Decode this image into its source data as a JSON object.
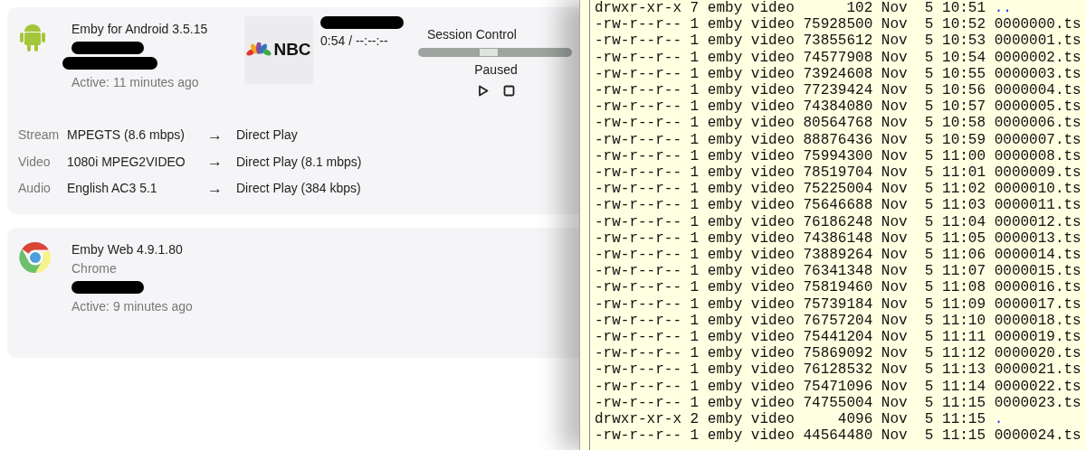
{
  "sessions": [
    {
      "kind": "android",
      "app": "Emby for Android 3.5.15",
      "redactions": [
        {
          "kind": "redaction"
        },
        {
          "kind": "redaction"
        }
      ],
      "active": "Active: 11 minutes ago",
      "media": {
        "logo": "NBC",
        "position": "0:54 / --:--:--"
      },
      "control": {
        "title": "Session Control",
        "level": 0.46,
        "state": "Paused"
      },
      "streams": [
        {
          "label": "Stream",
          "source": "MPEGTS (8.6 mbps)",
          "arrow": "→",
          "target": "Direct Play"
        },
        {
          "label": "Video",
          "source": "1080i MPEG2VIDEO",
          "arrow": "→",
          "target": "Direct Play (8.1 mbps)"
        },
        {
          "label": "Audio",
          "source": "English AC3 5.1",
          "arrow": "→",
          "target": "Direct Play (384 kbps)"
        }
      ]
    },
    {
      "kind": "chrome",
      "app": "Emby Web 4.9.1.80",
      "client": "Chrome",
      "redactions": [
        {
          "kind": "redaction"
        }
      ],
      "active": "Active: 9 minutes ago"
    }
  ],
  "terminal": {
    "lines": [
      {
        "info": "drwxr-xr-x 7 emby video      102 Nov  5 10:51",
        "name": "..",
        "kind": "dir"
      },
      {
        "info": "-rw-r--r-- 1 emby video 75928500 Nov  5 10:52",
        "name": "0000000.ts",
        "kind": "file"
      },
      {
        "info": "-rw-r--r-- 1 emby video 73855612 Nov  5 10:53",
        "name": "0000001.ts",
        "kind": "file"
      },
      {
        "info": "-rw-r--r-- 1 emby video 74577908 Nov  5 10:54",
        "name": "0000002.ts",
        "kind": "file"
      },
      {
        "info": "-rw-r--r-- 1 emby video 73924608 Nov  5 10:55",
        "name": "0000003.ts",
        "kind": "file"
      },
      {
        "info": "-rw-r--r-- 1 emby video 77239424 Nov  5 10:56",
        "name": "0000004.ts",
        "kind": "file"
      },
      {
        "info": "-rw-r--r-- 1 emby video 74384080 Nov  5 10:57",
        "name": "0000005.ts",
        "kind": "file"
      },
      {
        "info": "-rw-r--r-- 1 emby video 80564768 Nov  5 10:58",
        "name": "0000006.ts",
        "kind": "file"
      },
      {
        "info": "-rw-r--r-- 1 emby video 88876436 Nov  5 10:59",
        "name": "0000007.ts",
        "kind": "file"
      },
      {
        "info": "-rw-r--r-- 1 emby video 75994300 Nov  5 11:00",
        "name": "0000008.ts",
        "kind": "file"
      },
      {
        "info": "-rw-r--r-- 1 emby video 78519704 Nov  5 11:01",
        "name": "0000009.ts",
        "kind": "file"
      },
      {
        "info": "-rw-r--r-- 1 emby video 75225004 Nov  5 11:02",
        "name": "0000010.ts",
        "kind": "file"
      },
      {
        "info": "-rw-r--r-- 1 emby video 75646688 Nov  5 11:03",
        "name": "0000011.ts",
        "kind": "file"
      },
      {
        "info": "-rw-r--r-- 1 emby video 76186248 Nov  5 11:04",
        "name": "0000012.ts",
        "kind": "file"
      },
      {
        "info": "-rw-r--r-- 1 emby video 74386148 Nov  5 11:05",
        "name": "0000013.ts",
        "kind": "file"
      },
      {
        "info": "-rw-r--r-- 1 emby video 73889264 Nov  5 11:06",
        "name": "0000014.ts",
        "kind": "file"
      },
      {
        "info": "-rw-r--r-- 1 emby video 76341348 Nov  5 11:07",
        "name": "0000015.ts",
        "kind": "file"
      },
      {
        "info": "-rw-r--r-- 1 emby video 75819460 Nov  5 11:08",
        "name": "0000016.ts",
        "kind": "file"
      },
      {
        "info": "-rw-r--r-- 1 emby video 75739184 Nov  5 11:09",
        "name": "0000017.ts",
        "kind": "file"
      },
      {
        "info": "-rw-r--r-- 1 emby video 76757204 Nov  5 11:10",
        "name": "0000018.ts",
        "kind": "file"
      },
      {
        "info": "-rw-r--r-- 1 emby video 75441204 Nov  5 11:11",
        "name": "0000019.ts",
        "kind": "file"
      },
      {
        "info": "-rw-r--r-- 1 emby video 75869092 Nov  5 11:12",
        "name": "0000020.ts",
        "kind": "file"
      },
      {
        "info": "-rw-r--r-- 1 emby video 76128532 Nov  5 11:13",
        "name": "0000021.ts",
        "kind": "file"
      },
      {
        "info": "-rw-r--r-- 1 emby video 75471096 Nov  5 11:14",
        "name": "0000022.ts",
        "kind": "file"
      },
      {
        "info": "-rw-r--r-- 1 emby video 74755004 Nov  5 11:15",
        "name": "0000023.ts",
        "kind": "file"
      },
      {
        "info": "drwxr-xr-x 2 emby video     4096 Nov  5 11:15",
        "name": ".",
        "kind": "dir"
      },
      {
        "info": "-rw-r--r-- 1 emby video 44564480 Nov  5 11:15",
        "name": "0000024.ts",
        "kind": "file"
      }
    ]
  }
}
